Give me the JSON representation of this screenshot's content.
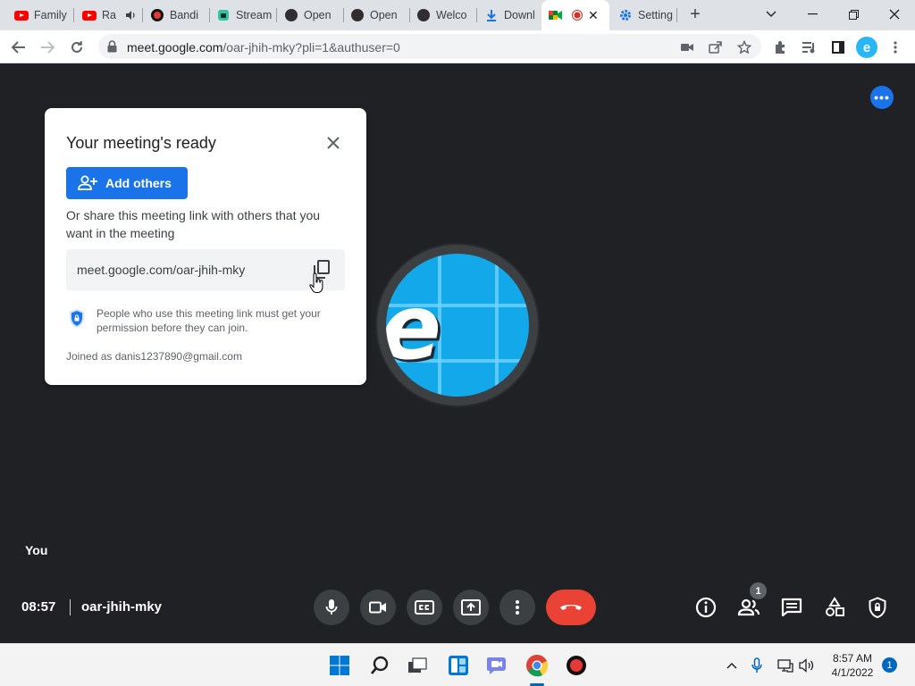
{
  "browser": {
    "tabs": [
      {
        "label": "Family",
        "icon": "youtube-icon"
      },
      {
        "label": "Ra",
        "icon": "youtube-icon",
        "audio": "speaker-icon"
      },
      {
        "label": "Bandi",
        "icon": "bandicam-icon"
      },
      {
        "label": "Stream",
        "icon": "streamlabs-icon"
      },
      {
        "label": "Open",
        "icon": "obs-icon"
      },
      {
        "label": "Open",
        "icon": "obs-icon"
      },
      {
        "label": "Welco",
        "icon": "obs-icon"
      },
      {
        "label": "Downl",
        "icon": "download-icon"
      },
      {
        "label": "",
        "icon": "meet-icon",
        "recording": "recording-icon",
        "active": true
      },
      {
        "label": "Setting",
        "icon": "settings-gear-icon"
      }
    ],
    "new_tab_label": "+",
    "address": {
      "host": "meet.google.com",
      "path": "/oar-jhih-mky?pli=1&authuser=0"
    },
    "profile_initial": "e"
  },
  "meet": {
    "card": {
      "title": "Your meeting's ready",
      "add_others": "Add others",
      "share_text": "Or share this meeting link with others that you want in the meeting",
      "link": "meet.google.com/oar-jhih-mky",
      "permission_text": "People who use this meeting link must get your permission before they can join.",
      "joined_as": "Joined as danis1237890@gmail.com"
    },
    "avatar_letter": "e",
    "self_label": "You",
    "time": "08:57",
    "meeting_code": "oar-jhih-mky",
    "participants_badge": "1",
    "colors": {
      "accent": "#1a73e8",
      "hangup": "#ea4335",
      "background": "#202124"
    }
  },
  "taskbar": {
    "time": "8:57 AM",
    "date": "4/1/2022",
    "notifications": "1"
  }
}
